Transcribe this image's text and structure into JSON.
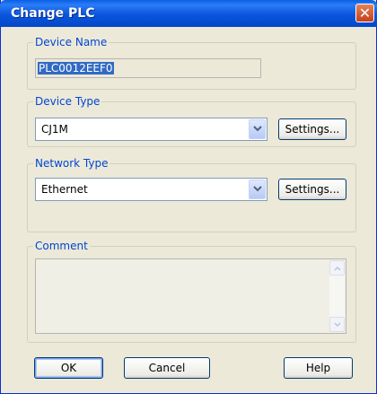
{
  "window": {
    "title": "Change PLC"
  },
  "device_name": {
    "legend": "Device Name",
    "value": "PLC0012EEF0"
  },
  "device_type": {
    "legend": "Device Type",
    "selected": "CJ1M",
    "settings_label": "Settings..."
  },
  "network_type": {
    "legend": "Network Type",
    "selected": "Ethernet",
    "settings_label": "Settings..."
  },
  "comment": {
    "legend": "Comment",
    "value": ""
  },
  "buttons": {
    "ok": "OK",
    "cancel": "Cancel",
    "help": "Help"
  },
  "icons": {
    "close": "close-icon",
    "dropdown": "chevron-down-icon",
    "scroll_up": "scroll-up-icon",
    "scroll_down": "scroll-down-icon"
  },
  "colors": {
    "title_bar": "#0a5fe6",
    "legend_text": "#0046d5",
    "selection": "#316ac5",
    "dialog_bg": "#ece9d8"
  }
}
